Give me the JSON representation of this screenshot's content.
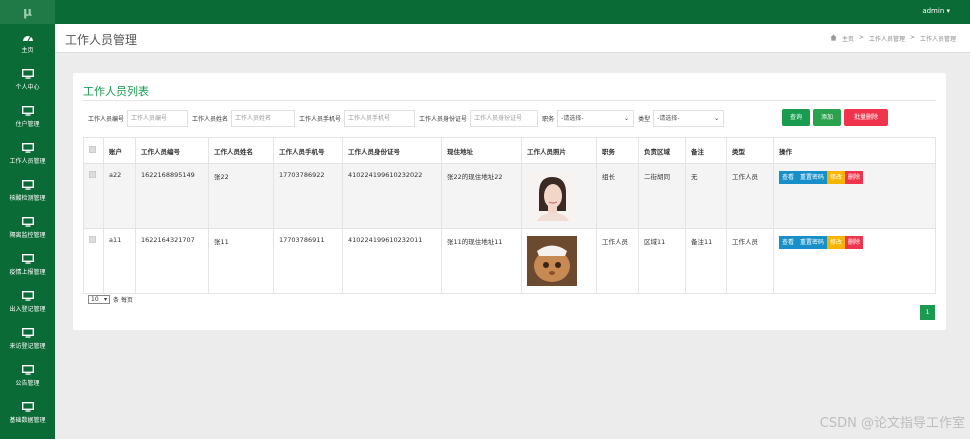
{
  "topbar": {
    "logo": "μ",
    "user": "admin ▾"
  },
  "sidebar": {
    "items": [
      {
        "label": "主页",
        "icon": "dashboard-icon"
      },
      {
        "label": "个人中心",
        "icon": "monitor-icon"
      },
      {
        "label": "住户管理",
        "icon": "monitor-icon"
      },
      {
        "label": "工作人员管理",
        "icon": "monitor-icon"
      },
      {
        "label": "核酸检测管理",
        "icon": "monitor-icon"
      },
      {
        "label": "隔离监控管理",
        "icon": "monitor-icon"
      },
      {
        "label": "疫情上报管理",
        "icon": "monitor-icon"
      },
      {
        "label": "出入登记管理",
        "icon": "monitor-icon"
      },
      {
        "label": "来访登记管理",
        "icon": "monitor-icon"
      },
      {
        "label": "公告管理",
        "icon": "monitor-icon"
      },
      {
        "label": "基础数据管理",
        "icon": "monitor-icon"
      }
    ]
  },
  "header": {
    "title": "工作人员管理",
    "breadcrumb": [
      "主页",
      ">",
      "工作人员管理",
      ">",
      "工作人员管理"
    ]
  },
  "panel": {
    "title": "工作人员列表",
    "filters": {
      "no_label": "工作人员编号",
      "no_placeholder": "工作人员编号",
      "name_label": "工作人员姓名",
      "name_placeholder": "工作人员姓名",
      "phone_label": "工作人员手机号",
      "phone_placeholder": "工作人员手机号",
      "id_label": "工作人员身份证号",
      "id_placeholder": "工作人员身份证号",
      "duty_label": "职务",
      "duty_value": "-请选择-",
      "type_label": "类型",
      "type_value": "-请选择-"
    },
    "buttons": {
      "query": "查询",
      "add": "添加",
      "batch_delete": "批量删除"
    },
    "table": {
      "headers": [
        "账户",
        "工作人员编号",
        "工作人员姓名",
        "工作人员手机号",
        "工作人员身份证号",
        "现住地址",
        "工作人员照片",
        "职务",
        "负责区域",
        "备注",
        "类型",
        "操作"
      ],
      "rows": [
        {
          "account": "a22",
          "no": "1622168895149",
          "name": "张22",
          "phone": "17703786922",
          "idcard": "410224199610232022",
          "address": "张22的现住地址22",
          "duty": "组长",
          "area": "二街胡同",
          "remark": "无",
          "type": "工作人员"
        },
        {
          "account": "a11",
          "no": "1622164321707",
          "name": "张11",
          "phone": "17703786911",
          "idcard": "410224199610232011",
          "address": "张11的现住地址11",
          "duty": "工作人员",
          "area": "区域11",
          "remark": "备注11",
          "type": "工作人员"
        }
      ],
      "actions": {
        "view": "查看",
        "reset_pwd": "重置密码",
        "edit": "修改",
        "delete": "删除"
      }
    },
    "footer": {
      "page_size": "10",
      "per_page_text": "条 每页",
      "current_page": "1"
    }
  },
  "watermark": "CSDN @论文指导工作室",
  "colors": {
    "brand": "#0b6b36",
    "accent": "#1a9c50",
    "view": "#1790c9",
    "edit": "#f5b400",
    "delete": "#f0344d"
  }
}
